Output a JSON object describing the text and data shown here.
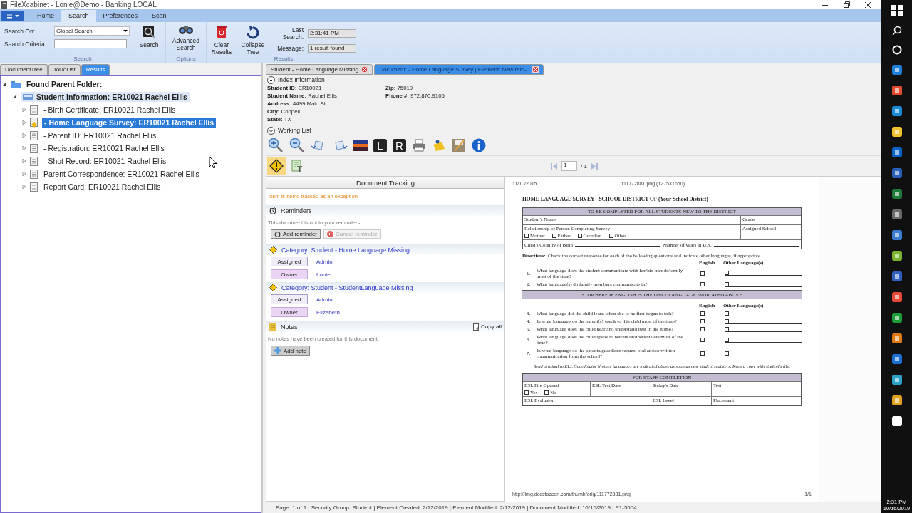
{
  "window": {
    "title": "FileXcabinet - Lonie@Demo - Banking LOCAL"
  },
  "ribbon_tabs": [
    {
      "label": "Home",
      "selected": false
    },
    {
      "label": "Search",
      "selected": true
    },
    {
      "label": "Preferences",
      "selected": false
    },
    {
      "label": "Scan",
      "selected": false
    }
  ],
  "ribbon": {
    "search_on_label": "Search On:",
    "search_on_value": "Global Search",
    "criteria_label": "Search Criteria:",
    "search_button": "Search",
    "group_search": "Search",
    "advanced_button": "Advanced Search",
    "group_options": "Options",
    "clear_button": "Clear Results",
    "collapse_button": "Collapse Tree",
    "last_search_label": "Last Search:",
    "last_search_value": "2:31:41 PM",
    "message_label": "Message:",
    "message_value": "1 result found",
    "group_results": "Results"
  },
  "left_tabs": [
    {
      "label": "DocumentTree",
      "selected": false
    },
    {
      "label": "ToDoList",
      "selected": false
    },
    {
      "label": "Results",
      "selected": true
    }
  ],
  "tree": {
    "label": "Found Parent Folder:",
    "expanded": true,
    "children": [
      {
        "label": "Student Information:  ER10021 Rachel Ellis",
        "expanded": true,
        "highlighted": true,
        "children": [
          {
            "label": "- Birth Certificate:  ER10021 Rachel Ellis",
            "selected": false,
            "flagged": false
          },
          {
            "label": "- Home Language Survey:  ER10021 Rachel Ellis",
            "selected": true,
            "flagged": true
          },
          {
            "label": "- Parent ID:  ER10021 Rachel Ellis",
            "selected": false,
            "flagged": false
          },
          {
            "label": "- Registration:  ER10021 Rachel Ellis",
            "selected": false,
            "flagged": false
          },
          {
            "label": "- Shot Record:  ER10021 Rachel Ellis",
            "selected": false,
            "flagged": false
          },
          {
            "label": "Parent Correspondence:  ER10021 Rachel Ellis",
            "selected": false,
            "flagged": false
          },
          {
            "label": "Report Card:  ER10021 Rachel Ellis",
            "selected": false,
            "flagged": false
          }
        ]
      }
    ]
  },
  "doc_tabs": [
    {
      "label": "Student - Home Language Missing",
      "selected": false
    },
    {
      "label": "Document: - Home Language Survey | Element: NewItem-0",
      "selected": true
    }
  ],
  "index_info": {
    "title": "Index Information",
    "expanded": true,
    "columns": [
      [
        {
          "label": "Student ID:",
          "value": "ER10021"
        },
        {
          "label": "Student Name:",
          "value": "Rachel Ellis"
        },
        {
          "label": "Address:",
          "value": "4499 Main St"
        },
        {
          "label": "City:",
          "value": "Coppell"
        },
        {
          "label": "State:",
          "value": "TX"
        }
      ],
      [
        {
          "label": "Zip:",
          "value": "75019"
        },
        {
          "label": "Phone #:",
          "value": "972.870.9105"
        }
      ]
    ]
  },
  "working_list": {
    "title": "Working List",
    "expanded": false
  },
  "toolbar": {
    "letter_buttons": [
      "L",
      "R"
    ]
  },
  "pager": {
    "page": "1",
    "total": "/ 1"
  },
  "tracking": {
    "title": "Document Tracking",
    "exception_message": "Item is being tracked as an exception",
    "reminders": {
      "title": "Reminders",
      "message": "This document is not in your reminders.",
      "buttons": [
        {
          "label": "Add reminder",
          "disabled": false
        },
        {
          "label": "Cancel reminder",
          "disabled": true
        }
      ]
    },
    "categories": [
      {
        "title": "Category: Student - Home Language Missing",
        "rows": [
          {
            "kind": "assigned",
            "role": "Assigned",
            "name": "Admin"
          },
          {
            "kind": "owner",
            "role": "Owner",
            "name": "Lonie"
          }
        ]
      },
      {
        "title": "Category: Student - StudentLanguage Missing",
        "rows": [
          {
            "kind": "assigned",
            "role": "Assigned",
            "name": "Admin"
          },
          {
            "kind": "owner",
            "role": "Owner",
            "name": "Elizabeth"
          }
        ]
      }
    ],
    "notes": {
      "title": "Notes",
      "copy_label": "Copy all",
      "message": "No notes have been created for this document.",
      "add_label": "Add note"
    }
  },
  "document": {
    "header_left": "11/10/2015",
    "header_center": "111772881.png (1275×1650)",
    "title": "HOME LANGUAGE SURVEY - SCHOOL DISTRICT OF (Your School District)",
    "section_title": "TO BE COMPLETED FOR ALL STUDENTS NEW TO THE DISTRICT",
    "student_name": "Student's Name",
    "grade": "Grade",
    "relationship": "Relationship of Person Completing Survey",
    "assigned_school": "Assigned School",
    "options": [
      "Mother",
      "Father",
      "Guardian",
      "Other"
    ],
    "country": "Child's Country of Birth",
    "years": "Number of years in U.S.",
    "directions_label": "Directions:",
    "directions": "Check the correct response for each of the following questions and indicate other languages, if appropriate.",
    "col_english": "English",
    "col_other": "Other Language(s)",
    "questions_a": [
      {
        "num": "1.",
        "text": "What language does the student communicate with her/his friends/family most of the time?"
      },
      {
        "num": "2.",
        "text": "What language(s) do family members communicate in?"
      }
    ],
    "stop_banner": "STOP HERE IF ENGLISH IS THE ONLY LANGUAGE INDICATED ABOVE",
    "col_english_b": "English",
    "col_other_b": "Other Language(s)",
    "questions_b": [
      {
        "num": "3.",
        "text": "What language did the child learn when she or he first began to talk?"
      },
      {
        "num": "4.",
        "text": "In what language do the parent(s) speak to this child most of the time?"
      },
      {
        "num": "5.",
        "text": "What language does the child hear and understand best in the home?"
      },
      {
        "num": "6.",
        "text": "What language does the child speak to her/his brothers/sisters most of the time?"
      },
      {
        "num": "7.",
        "text": "In what language do the parents/guardians request oral and/or written communication from the school?"
      }
    ],
    "note": "Send original to ELL Coordinator if other languages are indicated above as soon as new student registers. Keep a copy with student's file.",
    "staff_title": "FOR STAFF COMPLETION",
    "file_opened": "ESL File Opened",
    "yes": "Yes",
    "no": "No",
    "test_date": "ESL Test Date",
    "todays_date": "Today's Date",
    "test": "Test",
    "evaluator": "ESL Evaluator",
    "level": "ESL Level",
    "placement": "Placement",
    "footer_left": "http://img.docstoccdn.com/thumb/orig/111772881.png",
    "footer_right": "1/1"
  },
  "status_bar": "Page: 1 of 1 | Security Group: Student | Element Created: 2/12/2019 | Element Modified: 2/12/2019 | Document Modified: 10/16/2019 | E1-5554",
  "taskbar": {
    "time": "2:31 PM",
    "date": "10/16/2019"
  }
}
